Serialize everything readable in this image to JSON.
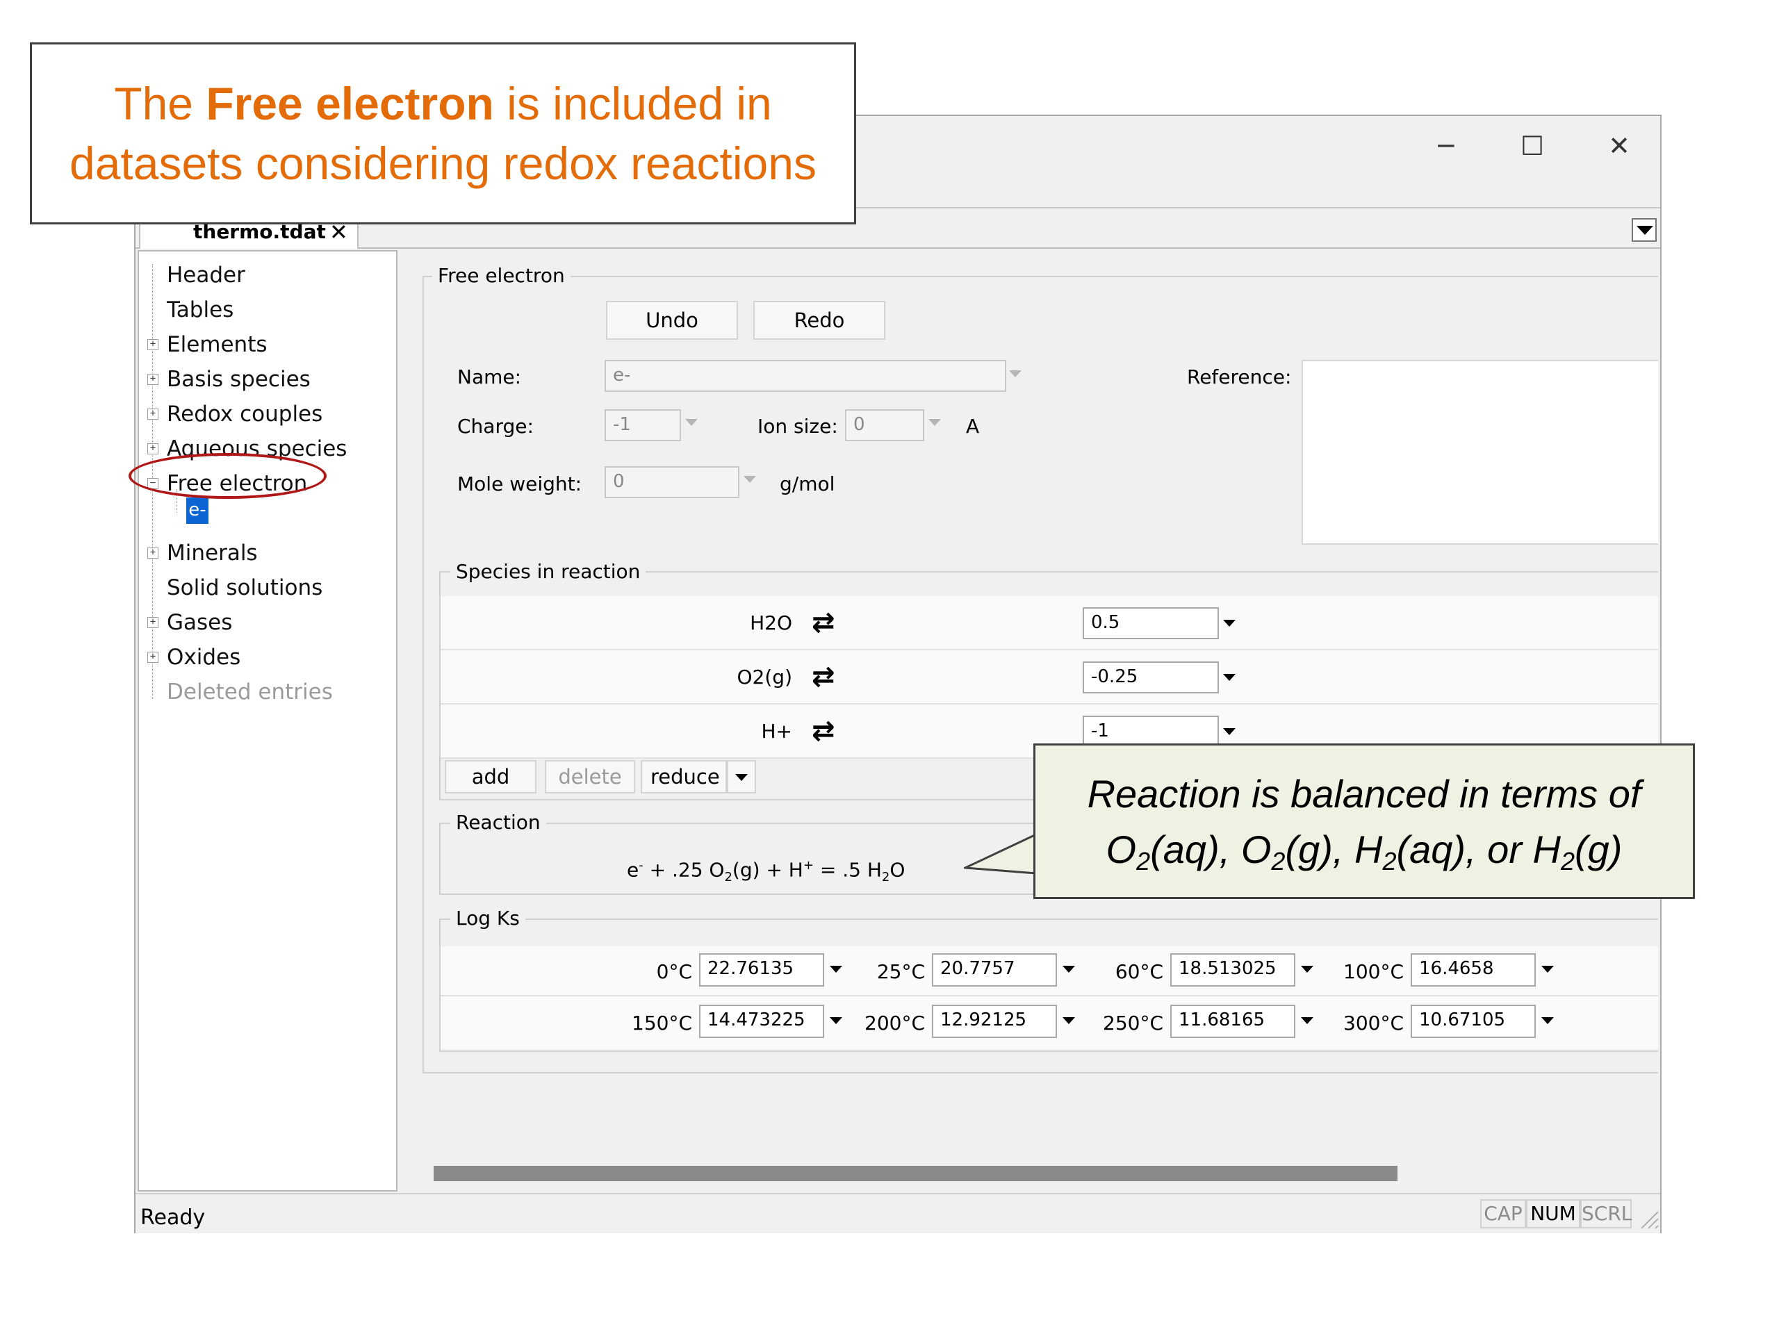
{
  "callouts": {
    "top_prefix": "The ",
    "top_bold": "Free electron",
    "top_suffix": " is included in",
    "top_line2": "datasets considering redox reactions",
    "right_line1": "Reaction is balanced in terms of",
    "right_line2_parts": [
      "O",
      "2",
      "(aq), O",
      "2",
      "(g), H",
      "2",
      "(aq), or H",
      "2",
      "(g)"
    ]
  },
  "window": {
    "minimize_glyph": "─",
    "maximize_glyph": "☐",
    "close_glyph": "✕",
    "tab_label": "thermo.tdat",
    "tab_close_glyph": "✕"
  },
  "tree": {
    "items": [
      {
        "label": "Header",
        "expandable": false
      },
      {
        "label": "Tables",
        "expandable": false
      },
      {
        "label": "Elements",
        "expandable": true,
        "glyph": "+"
      },
      {
        "label": "Basis species",
        "expandable": true,
        "glyph": "+"
      },
      {
        "label": "Redox couples",
        "expandable": true,
        "glyph": "+"
      },
      {
        "label": "Aqueous species",
        "expandable": true,
        "glyph": "+"
      },
      {
        "label": "Free electron",
        "expandable": true,
        "glyph": "−"
      },
      {
        "label": "Minerals",
        "expandable": true,
        "glyph": "+"
      },
      {
        "label": "Solid solutions",
        "expandable": false
      },
      {
        "label": "Gases",
        "expandable": true,
        "glyph": "+"
      },
      {
        "label": "Oxides",
        "expandable": true,
        "glyph": "+"
      },
      {
        "label": "Deleted entries",
        "expandable": false
      }
    ],
    "selected_child": "e-"
  },
  "form": {
    "group_title": "Free electron",
    "undo_label": "Undo",
    "redo_label": "Redo",
    "name_label": "Name:",
    "name_value": "e-",
    "reference_label": "Reference:",
    "charge_label": "Charge:",
    "charge_value": "-1",
    "ion_size_label": "Ion size:",
    "ion_size_value": "0",
    "ion_size_unit": "A",
    "mole_weight_label": "Mole weight:",
    "mole_weight_value": "0",
    "mole_weight_unit": "g/mol"
  },
  "species": {
    "group_title": "Species in reaction",
    "rows": [
      {
        "name": "H2O",
        "coef": "0.5"
      },
      {
        "name": "O2(g)",
        "coef": "-0.25"
      },
      {
        "name": "H+",
        "coef": "-1"
      }
    ],
    "swap_glyph": "⇄",
    "add_label": "add",
    "delete_label": "delete",
    "reduce_label": "reduce"
  },
  "reaction": {
    "group_title": "Reaction",
    "parts": {
      "e": "e",
      "e_sup": "-",
      "plus1": " + .25 O",
      "o_sub": "2",
      "g_plus": "(g) + H",
      "h_sup": "+",
      "eq": " = .5 H",
      "h2_sub": "2",
      "o_end": "O"
    }
  },
  "logks": {
    "group_title": "Log Ks",
    "rows": [
      [
        {
          "temp": "0°C",
          "value": "22.76135"
        },
        {
          "temp": "25°C",
          "value": "20.7757"
        },
        {
          "temp": "60°C",
          "value": "18.513025"
        },
        {
          "temp": "100°C",
          "value": "16.4658"
        }
      ],
      [
        {
          "temp": "150°C",
          "value": "14.473225"
        },
        {
          "temp": "200°C",
          "value": "12.92125"
        },
        {
          "temp": "250°C",
          "value": "11.68165"
        },
        {
          "temp": "300°C",
          "value": "10.67105"
        }
      ]
    ]
  },
  "status": {
    "ready": "Ready",
    "cap": "CAP",
    "num": "NUM",
    "scrl": "SCRL"
  }
}
